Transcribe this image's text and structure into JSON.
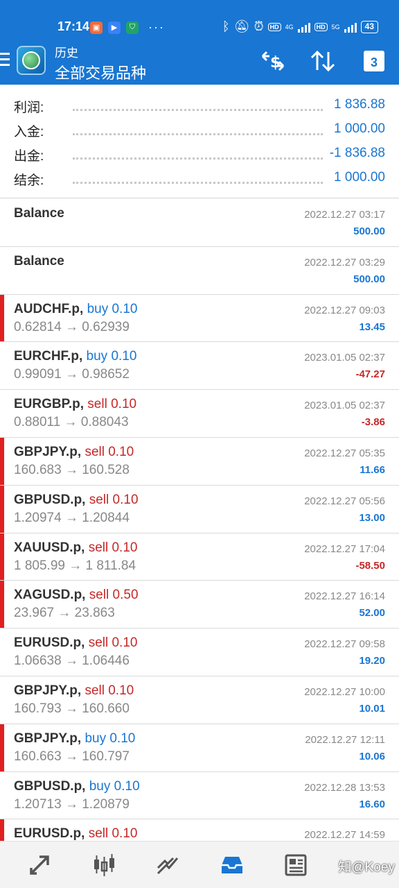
{
  "status_bar": {
    "time": "17:14",
    "tags": [
      "HD",
      "4G",
      "HD",
      "5G"
    ],
    "battery": "43",
    "more": "···"
  },
  "app_bar": {
    "subtitle": "历史",
    "title": "全部交易品种",
    "calendar_day": "3",
    "accent_color": "#1976d2"
  },
  "summary": [
    {
      "label": "利润:",
      "value": "1 836.88"
    },
    {
      "label": "入金:",
      "value": "1 000.00"
    },
    {
      "label": "出金:",
      "value": "-1 836.88"
    },
    {
      "label": "结余:",
      "value": "1 000.00"
    }
  ],
  "deals": [
    {
      "symbol": "Balance",
      "side": "",
      "volume": "",
      "prices": "",
      "time": "2022.12.27 03:17",
      "profit": "500.00",
      "marker": false
    },
    {
      "symbol": "Balance",
      "side": "",
      "volume": "",
      "prices": "",
      "time": "2022.12.27 03:29",
      "profit": "500.00",
      "marker": false
    },
    {
      "symbol": "AUDCHF.p,",
      "side": "buy",
      "volume": "0.10",
      "prices": "0.62814 → 0.62939",
      "time": "2022.12.27 09:03",
      "profit": "13.45",
      "marker": true
    },
    {
      "symbol": "EURCHF.p,",
      "side": "buy",
      "volume": "0.10",
      "prices": "0.99091 → 0.98652",
      "time": "2023.01.05 02:37",
      "profit": "-47.27",
      "marker": false
    },
    {
      "symbol": "EURGBP.p,",
      "side": "sell",
      "volume": "0.10",
      "prices": "0.88011 → 0.88043",
      "time": "2023.01.05 02:37",
      "profit": "-3.86",
      "marker": false
    },
    {
      "symbol": "GBPJPY.p,",
      "side": "sell",
      "volume": "0.10",
      "prices": "160.683 → 160.528",
      "time": "2022.12.27 05:35",
      "profit": "11.66",
      "marker": true
    },
    {
      "symbol": "GBPUSD.p,",
      "side": "sell",
      "volume": "0.10",
      "prices": "1.20974 → 1.20844",
      "time": "2022.12.27 05:56",
      "profit": "13.00",
      "marker": true
    },
    {
      "symbol": "XAUUSD.p,",
      "side": "sell",
      "volume": "0.10",
      "prices": "1 805.99 → 1 811.84",
      "time": "2022.12.27 17:04",
      "profit": "-58.50",
      "marker": true
    },
    {
      "symbol": "XAGUSD.p,",
      "side": "sell",
      "volume": "0.50",
      "prices": "23.967 → 23.863",
      "time": "2022.12.27 16:14",
      "profit": "52.00",
      "marker": true
    },
    {
      "symbol": "EURUSD.p,",
      "side": "sell",
      "volume": "0.10",
      "prices": "1.06638 → 1.06446",
      "time": "2022.12.27 09:58",
      "profit": "19.20",
      "marker": false
    },
    {
      "symbol": "GBPJPY.p,",
      "side": "sell",
      "volume": "0.10",
      "prices": "160.793 → 160.660",
      "time": "2022.12.27 10:00",
      "profit": "10.01",
      "marker": false
    },
    {
      "symbol": "GBPJPY.p,",
      "side": "buy",
      "volume": "0.10",
      "prices": "160.663 → 160.797",
      "time": "2022.12.27 12:11",
      "profit": "10.06",
      "marker": true
    },
    {
      "symbol": "GBPUSD.p,",
      "side": "buy",
      "volume": "0.10",
      "prices": "1.20713 → 1.20879",
      "time": "2022.12.28 13:53",
      "profit": "16.60",
      "marker": false
    },
    {
      "symbol": "EURUSD.p,",
      "side": "sell",
      "volume": "0.10",
      "prices": "",
      "time": "2022.12.27 14:59",
      "profit": "",
      "marker": true
    }
  ],
  "bottom_nav": {
    "items": [
      "quotes-icon",
      "chart-icon",
      "trade-icon",
      "history-icon",
      "news-icon"
    ],
    "active": "history-icon",
    "watermark": "知@Koey"
  }
}
